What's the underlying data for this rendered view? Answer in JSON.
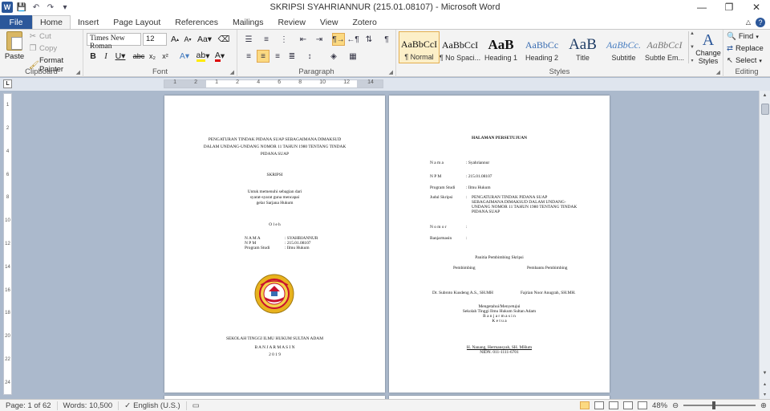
{
  "window": {
    "title": "SKRIPSI SYAHRIANNUR (215.01.08107)  -  Microsoft Word",
    "controls": {
      "minimize": "—",
      "restore": "❐",
      "close": "✕"
    }
  },
  "qat": {
    "save": "💾",
    "undo": "↶",
    "redo": "↷",
    "customize": "▾"
  },
  "tabs": {
    "file": "File",
    "items": [
      "Home",
      "Insert",
      "Page Layout",
      "References",
      "Mailings",
      "Review",
      "View",
      "Zotero"
    ],
    "active": "Home"
  },
  "ribbon": {
    "clipboard": {
      "label": "Clipboard",
      "paste": "Paste",
      "cut": "Cut",
      "copy": "Copy",
      "format_painter": "Format Painter"
    },
    "font": {
      "label": "Font",
      "name": "Times New Roman",
      "size": "12"
    },
    "paragraph": {
      "label": "Paragraph"
    },
    "styles": {
      "label": "Styles",
      "items": [
        {
          "sample": "AaBbCcI",
          "name": "¶ Normal"
        },
        {
          "sample": "AaBbCcI",
          "name": "¶ No Spaci..."
        },
        {
          "sample": "AaB",
          "name": "Heading 1"
        },
        {
          "sample": "AaBbCc",
          "name": "Heading 2"
        },
        {
          "sample": "AaB",
          "name": "Title"
        },
        {
          "sample": "AaBbCc.",
          "name": "Subtitle"
        },
        {
          "sample": "AaBbCcI",
          "name": "Subtle Em..."
        }
      ],
      "change_styles": "Change Styles"
    },
    "editing": {
      "label": "Editing",
      "find": "Find",
      "replace": "Replace",
      "select": "Select"
    }
  },
  "page1": {
    "title": [
      "PENGATURAN TINDAK PIDANA SUAP SEBAGAIMANA DIMAKSUD",
      "DALAM UNDANG-UNDANG NOMOR 11 TAHUN 1980 TENTANG TINDAK",
      "PIDANA SUAP"
    ],
    "doc_type": "SKRIPSI",
    "purpose": [
      "Untuk memenuhi sebagian dari",
      "syarat-syarat guna mencapai",
      "gelar Sarjana Hukum"
    ],
    "oleh": "O l e h",
    "fields": [
      {
        "label": "N A M A",
        "value": ": SYAHRIANNUR"
      },
      {
        "label": "N P M",
        "value": ": 215.01.08107"
      },
      {
        "label": "Program Studi",
        "value": ": Ilmu Hukum"
      }
    ],
    "institution": "SEKOLAH TINGGI ILMU HUKUM SULTAN ADAM",
    "city": "B A N J A R M A S I N",
    "year": "2 0 1 9"
  },
  "page2": {
    "heading": "HALAMAN PERSETUJUAN",
    "fields": [
      {
        "label": "N a m a",
        "value": ":     Syahriannur"
      },
      {
        "label": "N P M",
        "value": ":     215.01.08107"
      },
      {
        "label": "Program Studi",
        "value": ":     Ilmu Hukum"
      },
      {
        "label": "Judul Skripsi",
        "value": ":"
      },
      {
        "label": "N o m o r",
        "value": ":"
      },
      {
        "label": "Banjarmasin",
        "value": ":"
      }
    ],
    "judul": [
      "PENGATURAN    TINDAK    PIDANA    SUAP",
      "SEBAGAIMANA  DIMAKSUD  DALAM  UNDANG-",
      "UNDANG NOMOR 11 TAHUN 1980 TENTANG TINDAK",
      "PIDANA SUAP"
    ],
    "panitia": "Panitia Pembimbing Skripsi",
    "pembimbing": "Pembimbing",
    "pembantu": "Pembantu Pembimbing",
    "sig1": "Dr. Subroto Kusdeng A.S., SH.MH",
    "sig2": "Fajrian Noor Anugrah, SH.MH.",
    "approval": [
      "Mengetahui/Menyetujui",
      "Sekolah Tinggi Ilmu Hukum Sultan Adam",
      "B a n j a r m a s i n",
      "K e t u a"
    ],
    "ketua": "H. Nanang, Hermansyah, SH. MHum",
    "nidn": "NIDN. 011-1111-6701"
  },
  "status": {
    "page": "Page: 1 of 62",
    "words": "Words: 10,500",
    "lang": "English (U.S.)",
    "zoom": "48%"
  },
  "colors": {
    "accent": "#2b579a",
    "doc_bg": "#abb9cc",
    "logo_gold": "#e8b21e",
    "logo_red": "#c8102e"
  }
}
